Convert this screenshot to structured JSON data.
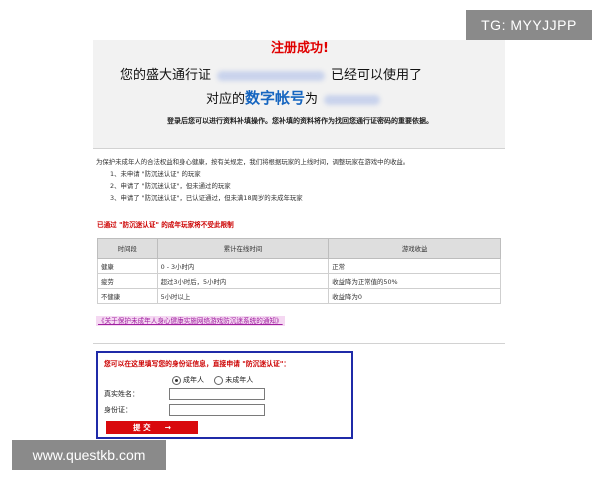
{
  "overlay": {
    "tg": "TG: MYYJJPP",
    "watermark": "www.questkb.com"
  },
  "header": {
    "success": "注册成功!",
    "line1_prefix": "您的盛大通行证",
    "line1_suffix": "已经可以使用了",
    "line2_prefix": "对应的",
    "line2_highlight": "数字帐号",
    "line2_suffix": "为",
    "tip": "登录后您可以进行资料补填操作。您补填的资料将作为找回您通行证密码的重要依据。"
  },
  "intro": {
    "text": "为保护未成年人的合法权益和身心健康，按有关规定，我们将根据玩家的上线时间，调整玩家在游戏中的收益。",
    "items": [
      "1、未申请 \"防沉迷认证\" 的玩家",
      "2、申请了 \"防沉迷认证\"，但未通过的玩家",
      "3、申请了 \"防沉迷认证\"，已认证通过，但未满18周岁的未成年玩家"
    ]
  },
  "warning": "已通过 \"防沉迷认证\" 的成年玩家将不受此限制",
  "table": {
    "headers": [
      "时间段",
      "累计在线时间",
      "游戏收益"
    ],
    "rows": [
      [
        "健康",
        "0 - 3小时内",
        "正常"
      ],
      [
        "疲劳",
        "超过3小时后，5小时内",
        "收益降为正常值的50%"
      ],
      [
        "不健康",
        "5小时以上",
        "收益降为0"
      ]
    ]
  },
  "notice_link": "《关于保护未成年人身心健康实施网络游戏防沉迷系统的通知》",
  "form": {
    "title": "您可以在这里填写您的身份证信息，直接申请 \"防沉迷认证\"：",
    "radio_adult": "成年人",
    "radio_minor": "未成年人",
    "name_label": "真实姓名：",
    "id_label": "身份证：",
    "name_value": "",
    "id_value": "",
    "submit": "提 交",
    "submit_arrow": "→"
  }
}
